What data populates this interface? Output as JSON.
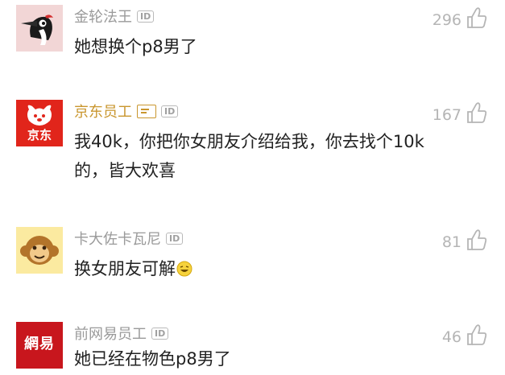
{
  "comments": [
    {
      "username": "金轮法王",
      "id_badge": "ID",
      "likes": "296",
      "text": "她想换个p8男了",
      "avatar": "woodpecker-avatar",
      "colors": {
        "avatar_bg": "#f2d6d6"
      }
    },
    {
      "username": "京东员工",
      "id_badge": "ID",
      "likes": "167",
      "text": "我40k，你把你女朋友介绍给我，你去找个10k的，皆大欢喜",
      "avatar": "jd-dog-avatar",
      "avatar_logo_text": "京东",
      "colors": {
        "avatar_bg": "#e1251b",
        "username": "#c9962e"
      }
    },
    {
      "username": "卡大佐卡瓦尼",
      "id_badge": "ID",
      "likes": "81",
      "text": "换女朋友可解",
      "avatar": "monkey-avatar",
      "colors": {
        "avatar_bg": "#fbeaa0"
      }
    },
    {
      "username": "前网易员工",
      "id_badge": "ID",
      "likes": "46",
      "text": "她已经在物色p8男了",
      "avatar": "netease-avatar",
      "avatar_logo_text": "網易",
      "colors": {
        "avatar_bg": "#c8161d"
      }
    }
  ]
}
